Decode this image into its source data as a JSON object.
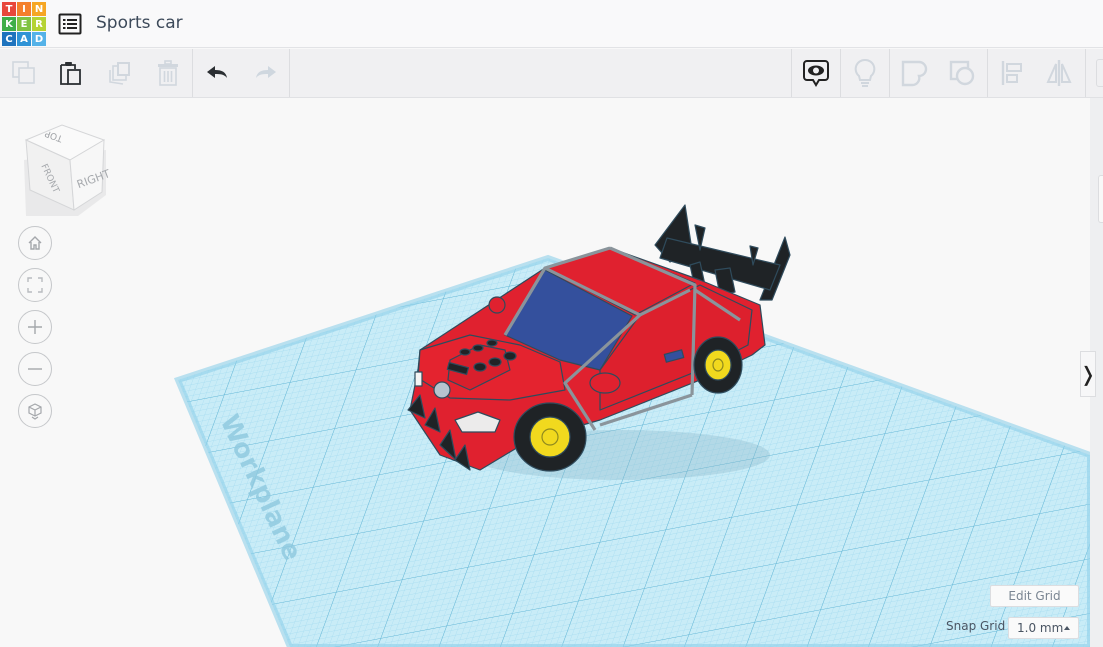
{
  "app": {
    "logo_letters": [
      "T",
      "I",
      "N",
      "K",
      "E",
      "R",
      "C",
      "A",
      "D"
    ],
    "logo_colors": [
      "#e8473c",
      "#f47f2b",
      "#f6a623",
      "#3fae49",
      "#80c342",
      "#b5d334",
      "#1e73be",
      "#2f93d6",
      "#54b2e8"
    ],
    "title": "Sports car"
  },
  "toolbar": {
    "left_tools": [
      {
        "name": "copy",
        "icon": "copy-icon",
        "enabled": false
      },
      {
        "name": "paste",
        "icon": "paste-icon",
        "enabled": true
      },
      {
        "name": "duplicate",
        "icon": "duplicate-icon",
        "enabled": false
      },
      {
        "name": "delete",
        "icon": "trash-icon",
        "enabled": false
      },
      {
        "name": "undo",
        "icon": "undo-icon",
        "enabled": true
      },
      {
        "name": "redo",
        "icon": "redo-icon",
        "enabled": false
      }
    ],
    "right_tools": [
      {
        "name": "show-all",
        "icon": "eye-bubble-icon",
        "enabled": true
      },
      {
        "name": "notes",
        "icon": "lightbulb-icon",
        "enabled": false
      },
      {
        "name": "group",
        "icon": "group-icon",
        "enabled": false
      },
      {
        "name": "ungroup",
        "icon": "ungroup-icon",
        "enabled": false
      },
      {
        "name": "align",
        "icon": "align-icon",
        "enabled": false
      },
      {
        "name": "mirror",
        "icon": "mirror-icon",
        "enabled": false
      }
    ]
  },
  "view_cube": {
    "faces": {
      "top": "TOP",
      "front": "FRONT",
      "right": "RIGHT"
    }
  },
  "nav_controls": [
    {
      "name": "home-view",
      "icon": "home-icon"
    },
    {
      "name": "fit-view",
      "icon": "fit-icon"
    },
    {
      "name": "zoom-in",
      "icon": "plus-icon"
    },
    {
      "name": "zoom-out",
      "icon": "minus-icon"
    },
    {
      "name": "projection",
      "icon": "cube-icon"
    }
  ],
  "workplane": {
    "label": "Workplane",
    "grid_color": "#7ecbe6"
  },
  "model": {
    "body_color": "#e0212f",
    "window_color": "#34509d",
    "wing_color": "#1f2326",
    "rim_color": "#f1d91e"
  },
  "grid_controls": {
    "edit_grid_label": "Edit Grid",
    "snap_grid_label": "Snap Grid",
    "snap_grid_value": "1.0 mm"
  },
  "panel_toggle": "❭"
}
